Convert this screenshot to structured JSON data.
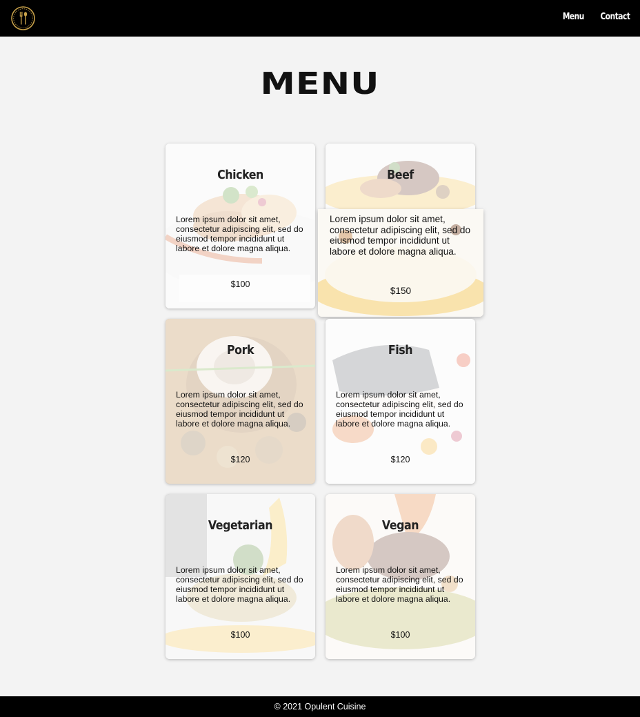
{
  "header": {
    "logo_icon": "fork-spoon-badge-icon",
    "nav": [
      {
        "label": "Menu"
      },
      {
        "label": "Contact"
      }
    ]
  },
  "page_title": "MENU",
  "menu_items": [
    {
      "name": "Chicken",
      "description": "Lorem ipsum dolor sit amet, consectetur adipiscing elit, sed do eiusmod tempor incididunt ut labore et dolore magna aliqua.",
      "price": "$100"
    },
    {
      "name": "Beef",
      "description": "Lorem ipsum dolor sit amet, consectetur adipiscing elit, sed do eiusmod tempor incididunt ut labore et dolore magna aliqua.",
      "price": "$150"
    },
    {
      "name": "Pork",
      "description": "Lorem ipsum dolor sit amet, consectetur adipiscing elit, sed do eiusmod tempor incididunt ut labore et dolore magna aliqua.",
      "price": "$120"
    },
    {
      "name": "Fish",
      "description": "Lorem ipsum dolor sit amet, consectetur adipiscing elit, sed do eiusmod tempor incididunt ut labore et dolore magna aliqua.",
      "price": "$120"
    },
    {
      "name": "Vegetarian",
      "description": "Lorem ipsum dolor sit amet, consectetur adipiscing elit, sed do eiusmod tempor incididunt ut labore et dolore magna aliqua.",
      "price": "$100"
    },
    {
      "name": "Vegan",
      "description": "Lorem ipsum dolor sit amet, consectetur adipiscing elit, sed do eiusmod tempor incididunt ut labore et dolore magna aliqua.",
      "price": "$100"
    }
  ],
  "footer": {
    "copyright": "© 2021 Opulent Cuisine"
  },
  "colors": {
    "header_bg": "#000000",
    "page_bg": "#f3f3f3",
    "logo_gold": "#c9a24a"
  }
}
